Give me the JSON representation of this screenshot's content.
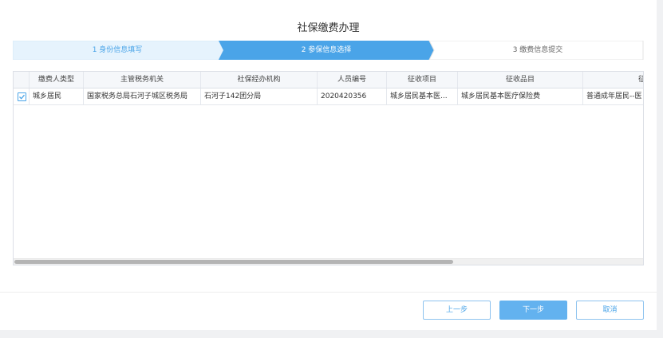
{
  "dialog": {
    "title": "社保缴费办理"
  },
  "steps": [
    {
      "label": "1 身份信息填写",
      "state": "done"
    },
    {
      "label": "2 参保信息选择",
      "state": "active"
    },
    {
      "label": "3 缴费信息提交",
      "state": "pending"
    }
  ],
  "colors": {
    "step_done_bg": "#e6f3fd",
    "step_active_bg": "#4aa4e8",
    "step_pending_bg": "#ffffff",
    "accent": "#4aa4e8",
    "primary_button": "#63b2ef"
  },
  "table": {
    "columns": [
      "缴费人类型",
      "主管税务机关",
      "社保经办机构",
      "人员编号",
      "征收项目",
      "征收品目",
      "征收子目"
    ],
    "rows": [
      {
        "checked": true,
        "cells": [
          "城乡居民",
          "国家税务总局石河子城区税务局",
          "石河子142团分局",
          "2020420356",
          "城乡居民基本医...",
          "城乡居民基本医疗保险费",
          "普通成年居民--医"
        ]
      }
    ]
  },
  "buttons": {
    "prev": "上一步",
    "next": "下一步",
    "cancel": "取消"
  }
}
